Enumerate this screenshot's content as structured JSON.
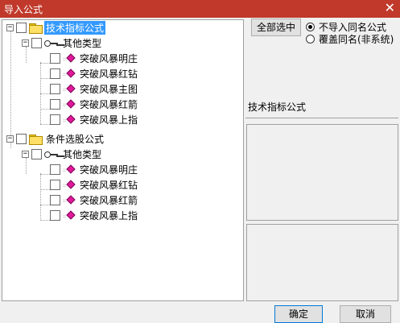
{
  "window": {
    "title": "导入公式",
    "close_glyph": "✕"
  },
  "tree": {
    "groups": [
      {
        "label": "技术指标公式",
        "selected": true,
        "subgroup": {
          "label": "其他类型",
          "items": [
            "突破风暴明庄",
            "突破风暴红钻",
            "突破风暴主图",
            "突破风暴红箭",
            "突破风暴上指"
          ]
        }
      },
      {
        "label": "条件选股公式",
        "selected": false,
        "subgroup": {
          "label": "其他类型",
          "items": [
            "突破风暴明庄",
            "突破风暴红钻",
            "突破风暴红箭",
            "突破风暴上指"
          ]
        }
      }
    ]
  },
  "right": {
    "select_all_label": "全部选中",
    "option_no_import": "不导入同名公式",
    "option_overwrite": "覆盖同名(非系统)",
    "selected_option": "no_import",
    "formula_name": "技术指标公式"
  },
  "footer": {
    "ok_label": "确定",
    "cancel_label": "取消"
  },
  "colors": {
    "title_bar": "#c0392b",
    "selection": "#3399ff",
    "formula_gem": "#e0189a",
    "folder": "#ffe066"
  },
  "icons": {
    "folder": "folder-icon",
    "type": "key-icon",
    "formula": "formula-gem-icon",
    "expander": "minus-expander-icon"
  }
}
